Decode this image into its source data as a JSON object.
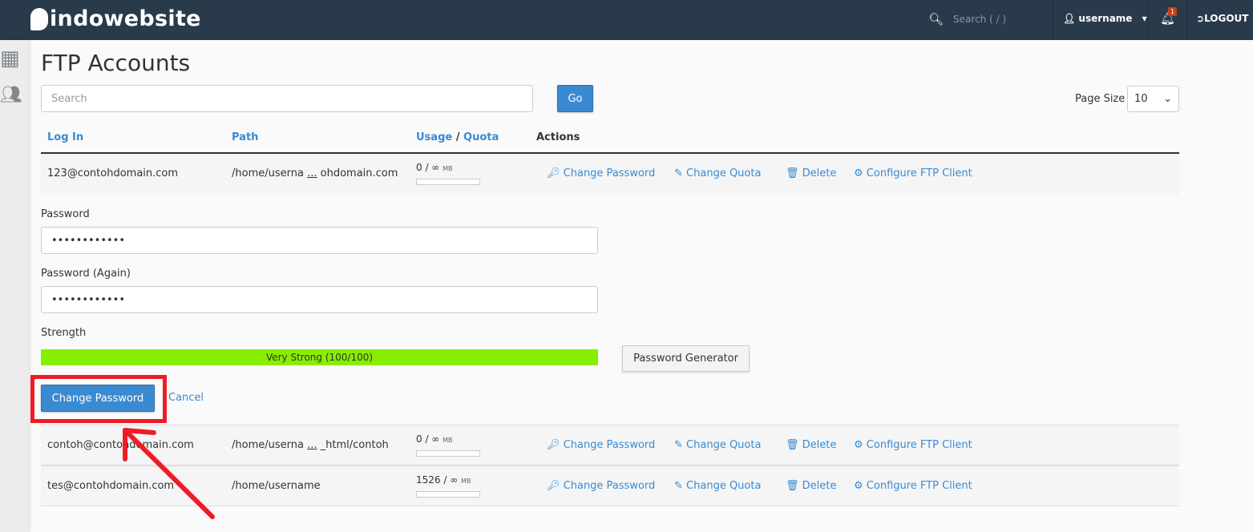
{
  "header": {
    "brand": "indowebsite",
    "search_placeholder": "Search ( / )",
    "username": "username",
    "notifications": "1",
    "logout": "LOGOUT"
  },
  "page": {
    "title": "FTP Accounts",
    "search_placeholder": "Search",
    "go": "Go",
    "page_size_label": "Page Size",
    "page_size": "10"
  },
  "table": {
    "headers": {
      "login": "Log In",
      "path": "Path",
      "usage": "Usage",
      "slash": " / ",
      "quota": "Quota",
      "actions": "Actions"
    },
    "actions": {
      "change_password": "Change Password",
      "change_quota": "Change Quota",
      "delete": "Delete",
      "configure": "Configure FTP Client"
    },
    "rows": [
      {
        "login": "123@contohdomain.com",
        "path_start": "/home/userna",
        "ellipsis": "...",
        "path_end": "ohdomain.com",
        "usage": "0 / ∞",
        "unit": "MB",
        "fill": 0
      },
      {
        "login": "contoh@contohdomain.com",
        "path_start": "/home/userna",
        "ellipsis": "...",
        "path_end": "_html/contoh",
        "usage": "0 / ∞",
        "unit": "MB",
        "fill": 0
      },
      {
        "login": "tes@contohdomain.com",
        "path_start": "/home/username",
        "ellipsis": "",
        "path_end": "",
        "usage": "1526 / ∞",
        "unit": "MB",
        "fill": 0
      }
    ]
  },
  "form": {
    "password_label": "Password",
    "password_value": "••••••••••••",
    "password_again_label": "Password (Again)",
    "password_again_value": "••••••••••••",
    "strength_label": "Strength",
    "strength_text": "Very Strong (100/100)",
    "strength_percent": 100,
    "strength_color": "#88ee00",
    "generator": "Password Generator",
    "submit": "Change Password",
    "cancel": "Cancel"
  },
  "annotation": {
    "color": "#ee1c25"
  }
}
